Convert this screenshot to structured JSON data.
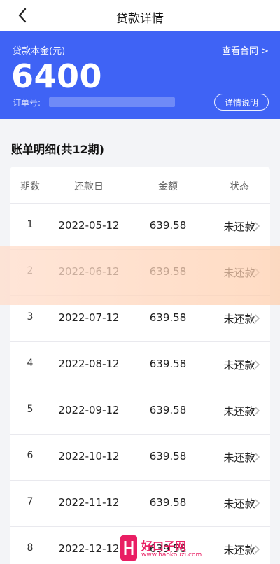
{
  "nav": {
    "title": "贷款详情",
    "back_icon": "chevron-left-icon"
  },
  "loan": {
    "principal_label": "贷款本金(元)",
    "principal_value": "6400",
    "contract_link": "查看合同 >",
    "order_label": "订单号:",
    "details_button": "详情说明"
  },
  "bill": {
    "title": "账单明细(共12期)",
    "headers": {
      "period": "期数",
      "due_date": "还款日",
      "amount": "金额",
      "status": "状态"
    },
    "rows": [
      {
        "period": "1",
        "date": "2022-05-12",
        "amount": "639.58",
        "status": "未还款"
      },
      {
        "period": "2",
        "date": "2022-06-12",
        "amount": "639.58",
        "status": "未还款"
      },
      {
        "period": "3",
        "date": "2022-07-12",
        "amount": "639.58",
        "status": "未还款"
      },
      {
        "period": "4",
        "date": "2022-08-12",
        "amount": "639.58",
        "status": "未还款"
      },
      {
        "period": "5",
        "date": "2022-09-12",
        "amount": "639.58",
        "status": "未还款"
      },
      {
        "period": "6",
        "date": "2022-10-12",
        "amount": "639.58",
        "status": "未还款"
      },
      {
        "period": "7",
        "date": "2022-11-12",
        "amount": "639.58",
        "status": "未还款"
      },
      {
        "period": "8",
        "date": "2022-12-12",
        "amount": "639.58",
        "status": "未还款"
      }
    ]
  },
  "watermark": {
    "brand": "好口子网",
    "site": "www.haokouzi.com"
  },
  "colors": {
    "primary": "#3f63f5",
    "background": "#f3f4f7"
  }
}
